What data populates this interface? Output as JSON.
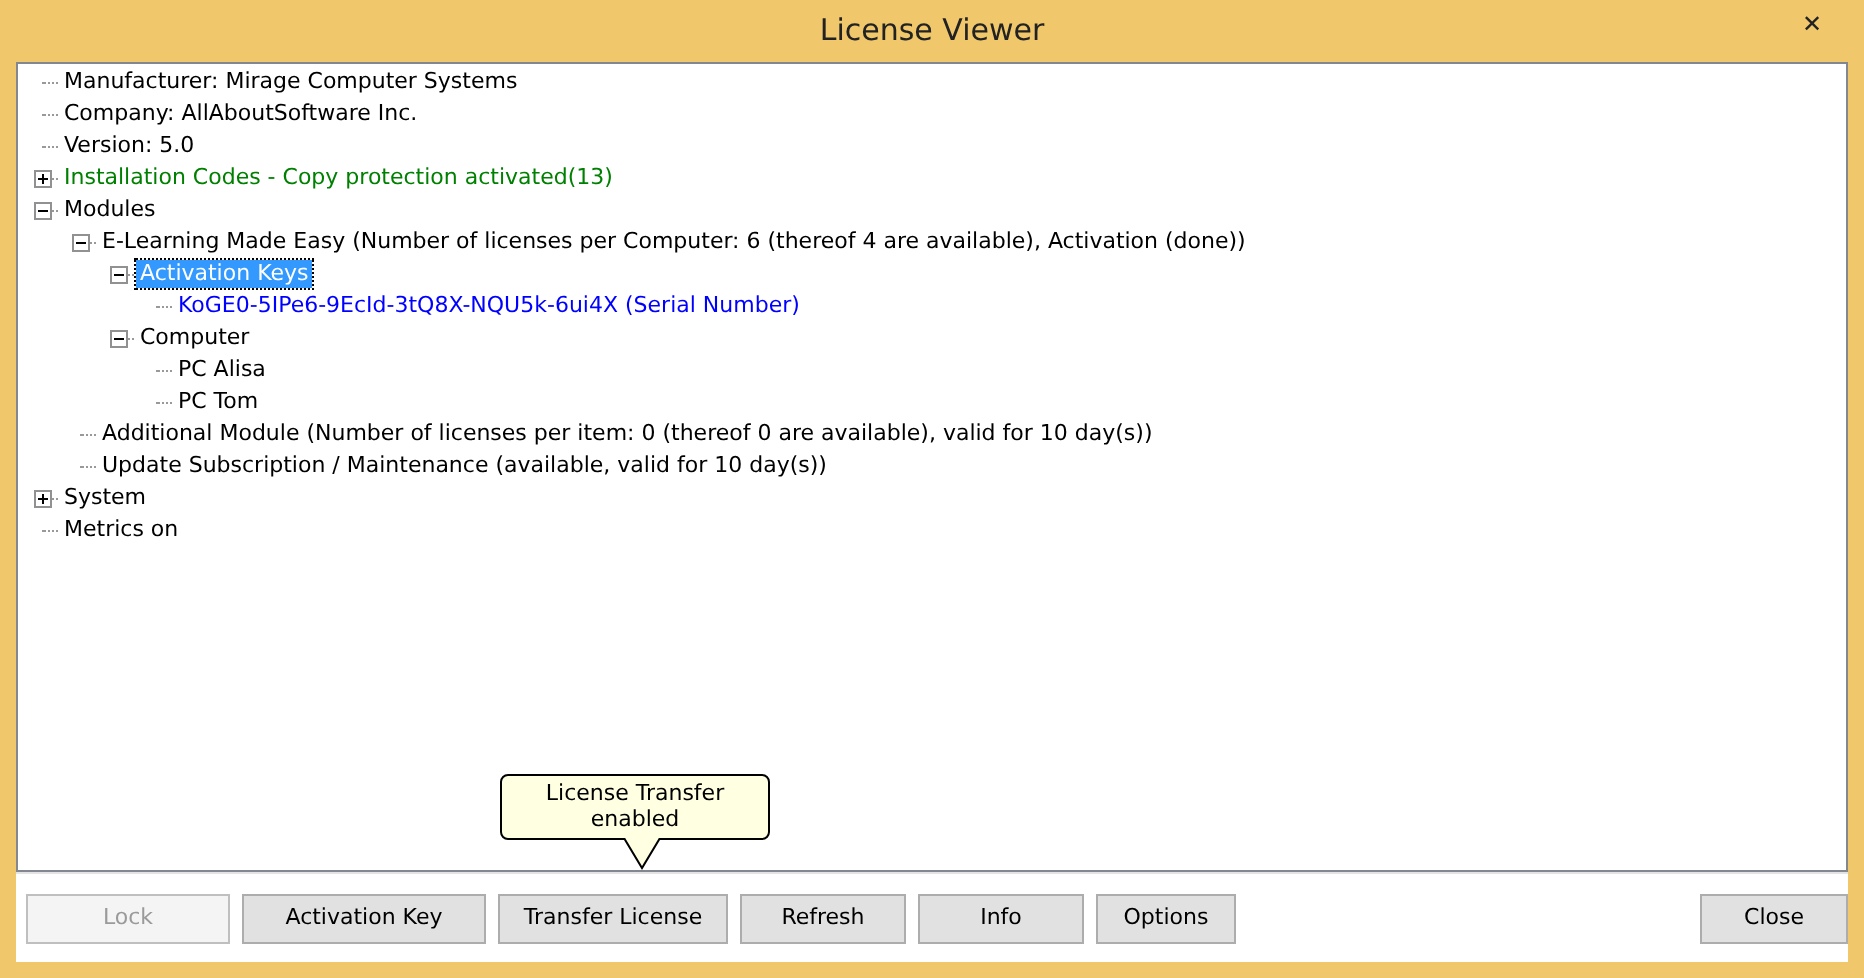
{
  "window": {
    "title": "License Viewer",
    "close": "✕"
  },
  "tree": [
    {
      "label": "Manufacturer: Mirage Computer Systems"
    },
    {
      "label": "Company: AllAboutSoftware Inc."
    },
    {
      "label": "Version: 5.0"
    },
    {
      "label": "Installation Codes - Copy protection activated(13)",
      "expanded": false,
      "color": "#008000"
    },
    {
      "label": "Modules",
      "expanded": true,
      "children": [
        {
          "label": "E-Learning Made Easy (Number of licenses per Computer: 6 (thereof 4 are available), Activation (done))",
          "expanded": true,
          "children": [
            {
              "label": "Activation Keys",
              "expanded": true,
              "selected": true,
              "children": [
                {
                  "label": "KoGE0-5IPe6-9EcId-3tQ8X-NQU5k-6ui4X (Serial Number)",
                  "color": "#0000ff",
                  "selected": false
                }
              ]
            },
            {
              "label": "Computer",
              "expanded": true,
              "selected": false,
              "children": [
                {
                  "label": "PC Alisa",
                  "selected": false
                },
                {
                  "label": "PC Tom",
                  "selected": false
                }
              ]
            }
          ]
        },
        {
          "label": "Additional Module (Number of licenses per item: 0 (thereof 0 are available), valid for 10 day(s))"
        },
        {
          "label": "Update Subscription / Maintenance (available, valid for 10 day(s))"
        }
      ]
    },
    {
      "label": "System",
      "expanded": false
    },
    {
      "label": "Metrics on"
    }
  ],
  "tooltip": {
    "text": "License Transfer enabled"
  },
  "buttons": [
    {
      "label": "Lock",
      "disabled": true
    },
    {
      "label": "Activation Key",
      "disabled": false
    },
    {
      "label": "Transfer License",
      "disabled": false
    },
    {
      "label": "Refresh",
      "disabled": false
    },
    {
      "label": "Info",
      "disabled": false
    },
    {
      "label": "Options",
      "disabled": false
    }
  ],
  "close_button": {
    "label": "Close"
  }
}
